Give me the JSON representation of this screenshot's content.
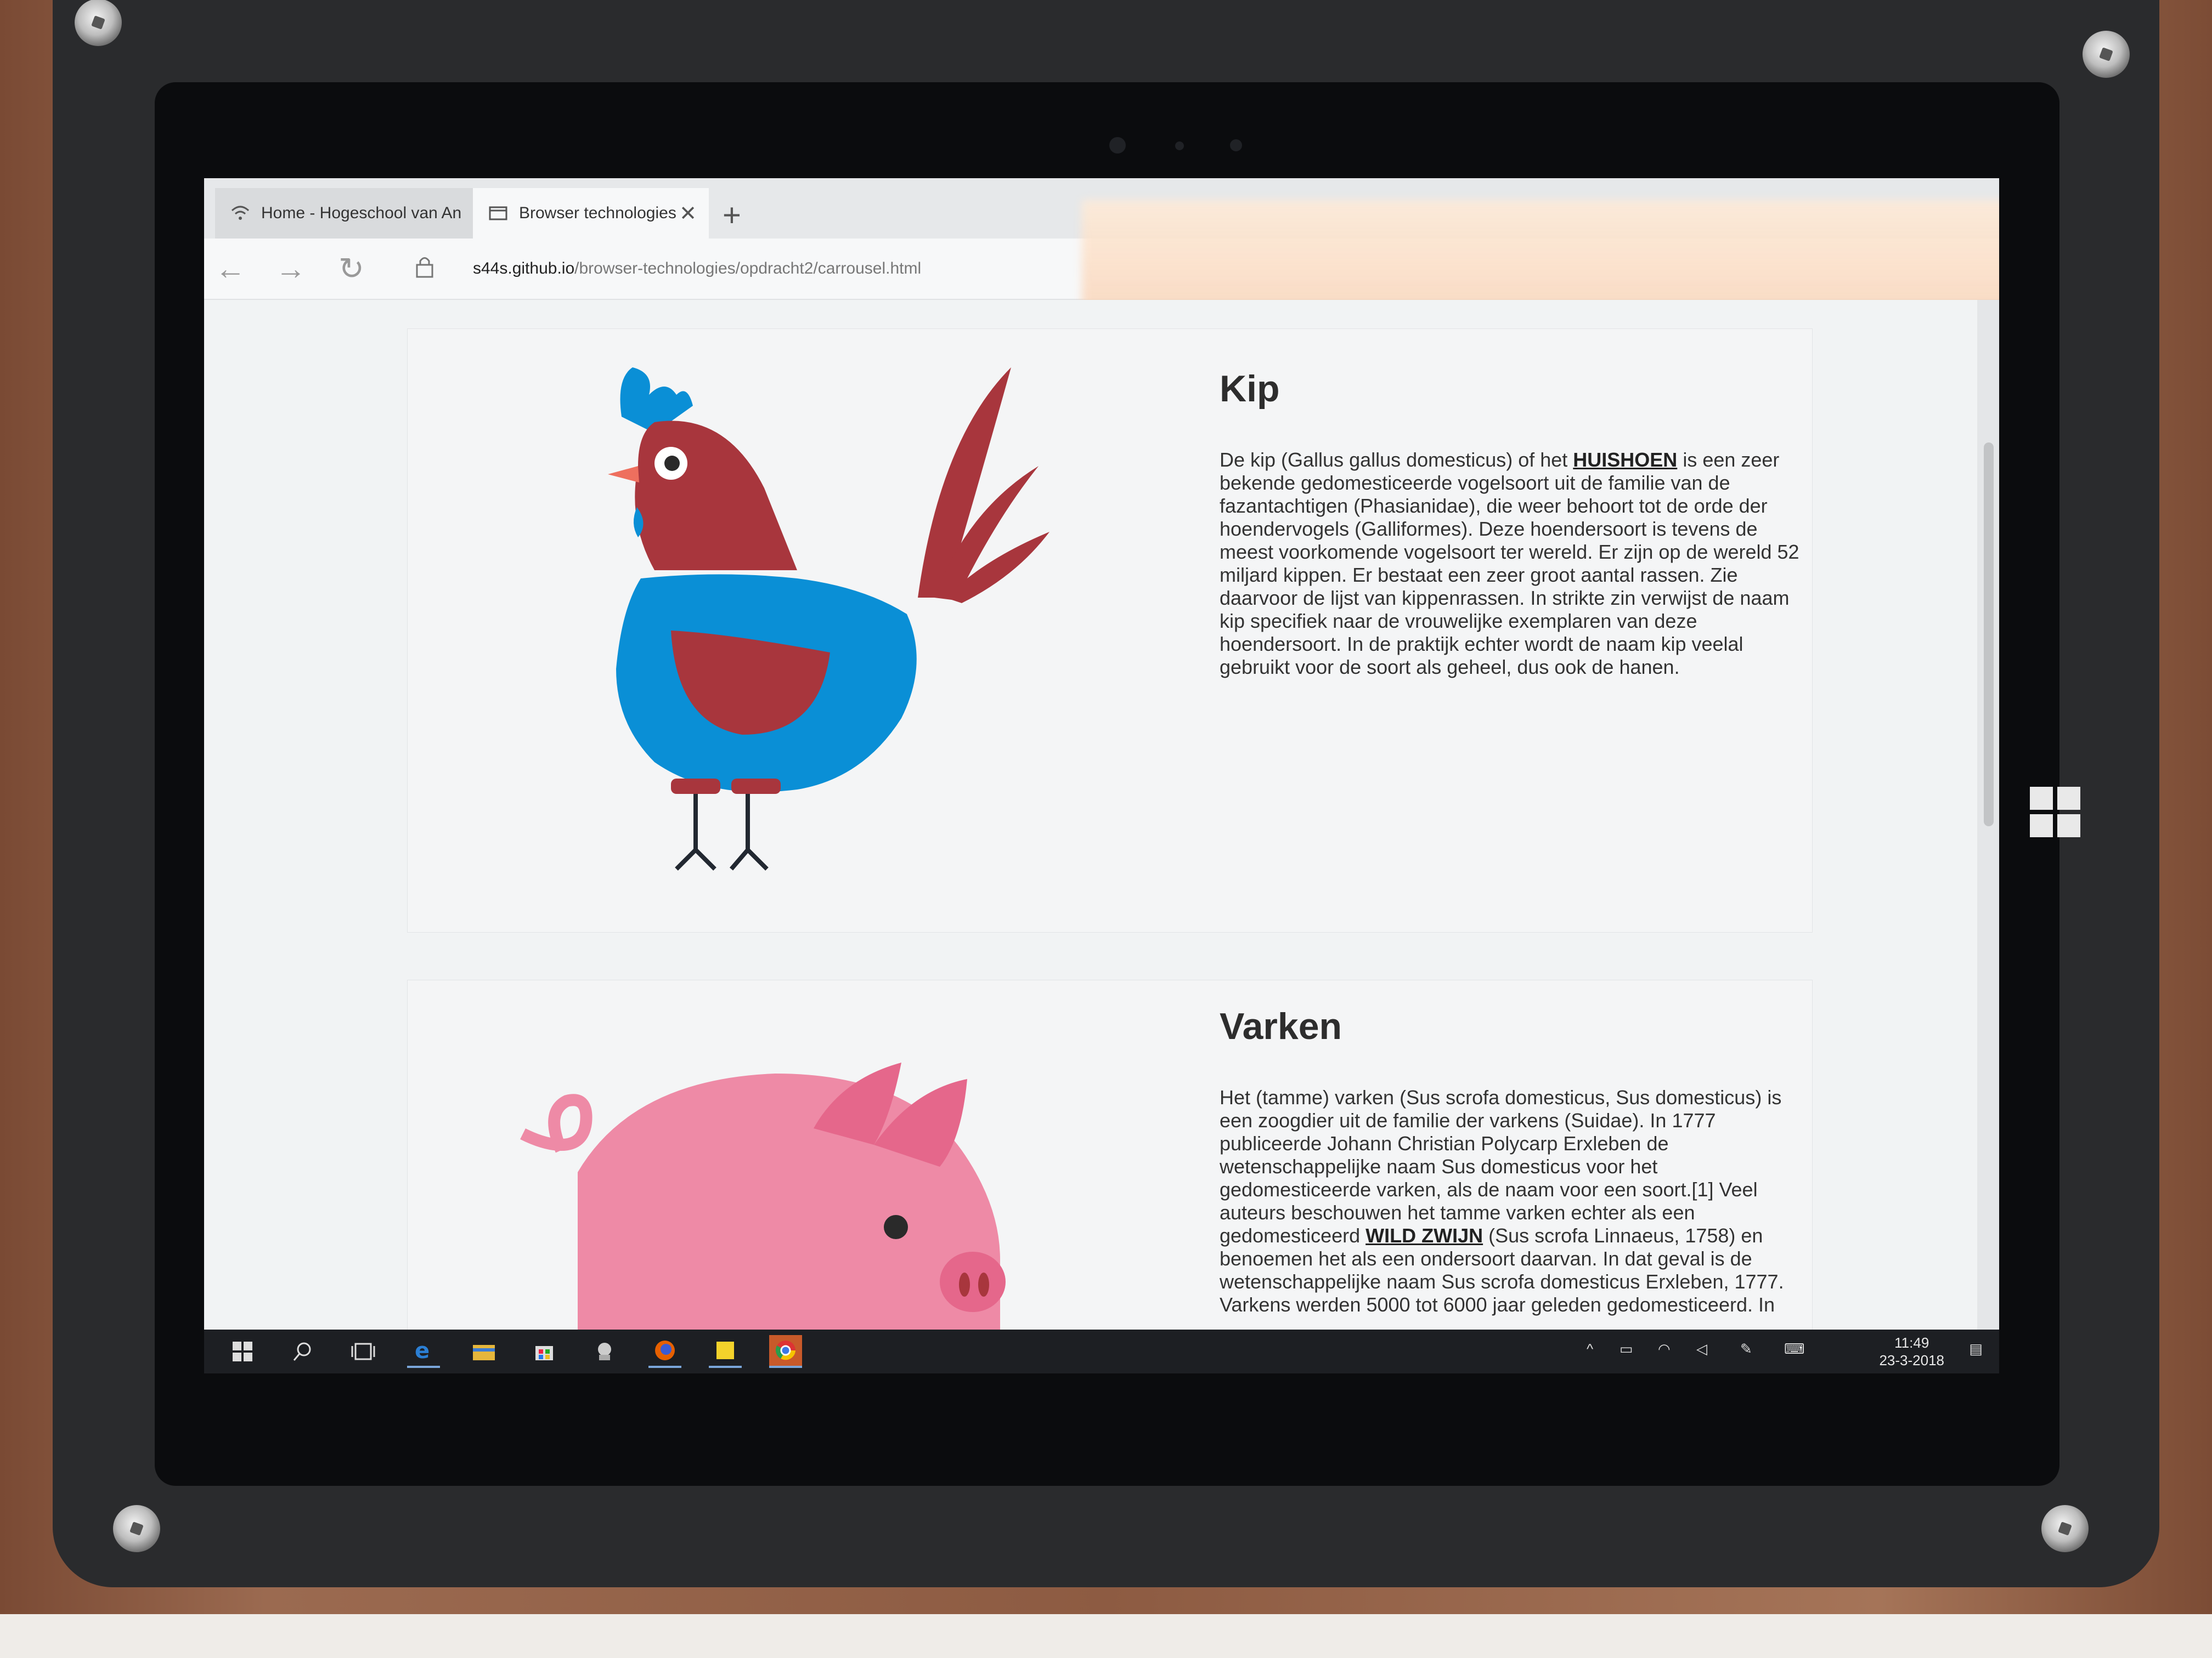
{
  "browser": {
    "tabs": [
      {
        "label": "Home - Hogeschool van An",
        "active": false
      },
      {
        "label": "Browser technologies",
        "active": true
      }
    ],
    "url": {
      "host": "s44s.github.io",
      "path": "/browser-technologies/opdracht2/carrousel.html"
    }
  },
  "cards": [
    {
      "title": "Kip",
      "image": "chicken-illustration",
      "text_before": "De kip (Gallus gallus domesticus) of het ",
      "link": "HUISHOEN",
      "text_after": " is een zeer bekende gedomesticeerde vogelsoort uit de familie van de fazantachtigen (Phasianidae), die weer behoort tot de orde der hoendervogels (Galliformes). Deze hoendersoort is tevens de meest voorkomende vogelsoort ter wereld. Er zijn op de wereld 52 miljard kippen. Er bestaat een zeer groot aantal rassen. Zie daarvoor de lijst van kippenrassen. In strikte zin verwijst de naam kip specifiek naar de vrouwelijke exemplaren van deze hoendersoort. In de praktijk echter wordt de naam kip veelal gebruikt voor de soort als geheel, dus ook de hanen."
    },
    {
      "title": "Varken",
      "image": "pig-illustration",
      "text_before": "Het (tamme) varken (Sus scrofa domesticus, Sus domesticus) is een zoogdier uit de familie der varkens (Suidae). In 1777 publiceerde Johann Christian Polycarp Erxleben de wetenschappelijke naam Sus domesticus voor het gedomesticeerde varken, als de naam voor een soort.[1] Veel auteurs beschouwen het tamme varken echter als een gedomesticeerd ",
      "link": "WILD ZWIJN",
      "text_after": " (Sus scrofa Linnaeus, 1758) en benoemen het als een ondersoort daarvan. In dat geval is de wetenschappelijke naam Sus scrofa domesticus Erxleben, 1777. Varkens werden 5000 tot 6000 jaar geleden gedomesticeerd. In"
    }
  ],
  "taskbar": {
    "time": "11:49",
    "date": "23-3-2018",
    "icons": [
      "windows-start-icon",
      "search-icon",
      "task-view-icon",
      "edge-icon",
      "file-explorer-icon",
      "store-icon",
      "app-icon",
      "firefox-icon",
      "sticky-notes-icon",
      "chrome-icon"
    ]
  },
  "colors": {
    "chicken_blue": "#0a8fd6",
    "chicken_red": "#a8363d",
    "pig_pink": "#ee8aa6"
  }
}
